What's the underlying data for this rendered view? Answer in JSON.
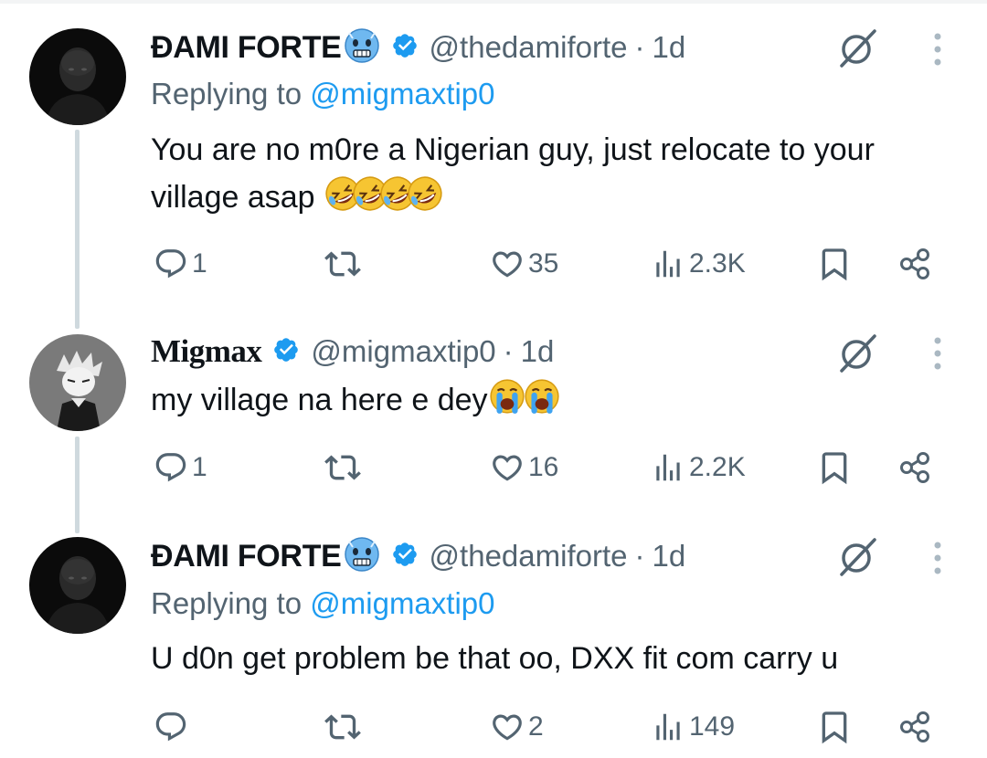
{
  "tweets": [
    {
      "name": "ĐAMI FORTE",
      "name_emoji": "cold-face-emoji",
      "handle": "@thedamiforte",
      "separator": "·",
      "time": "1d",
      "replying_prefix": "Replying to ",
      "replying_handle": "@migmaxtip0",
      "text_line1": "You are no m0re a Nigerian guy, just relocate to your",
      "text_line2": "village asap",
      "text_emojis": [
        "rofl-emoji",
        "rofl-emoji",
        "rofl-emoji",
        "rofl-emoji"
      ],
      "replies": "1",
      "retweets": "",
      "likes": "35",
      "views": "2.3K"
    },
    {
      "name": "Migmax",
      "handle": "@migmaxtip0",
      "separator": "·",
      "time": "1d",
      "text_line1": "my village na here e dey",
      "text_emojis": [
        "crying-face-emoji",
        "crying-face-emoji"
      ],
      "replies": "1",
      "retweets": "",
      "likes": "16",
      "views": "2.2K"
    },
    {
      "name": "ĐAMI FORTE",
      "name_emoji": "cold-face-emoji",
      "handle": "@thedamiforte",
      "separator": "·",
      "time": "1d",
      "replying_prefix": "Replying to ",
      "replying_handle": "@migmaxtip0",
      "text_line1": "U d0n get problem be that oo, DXX fit com carry u",
      "replies": "",
      "retweets": "",
      "likes": "2",
      "views": "149"
    }
  ],
  "colors": {
    "text": "#0f1419",
    "muted": "#536471",
    "link": "#1d9bf0",
    "verified": "#1d9bf0",
    "thread_line": "#cfd9de"
  }
}
